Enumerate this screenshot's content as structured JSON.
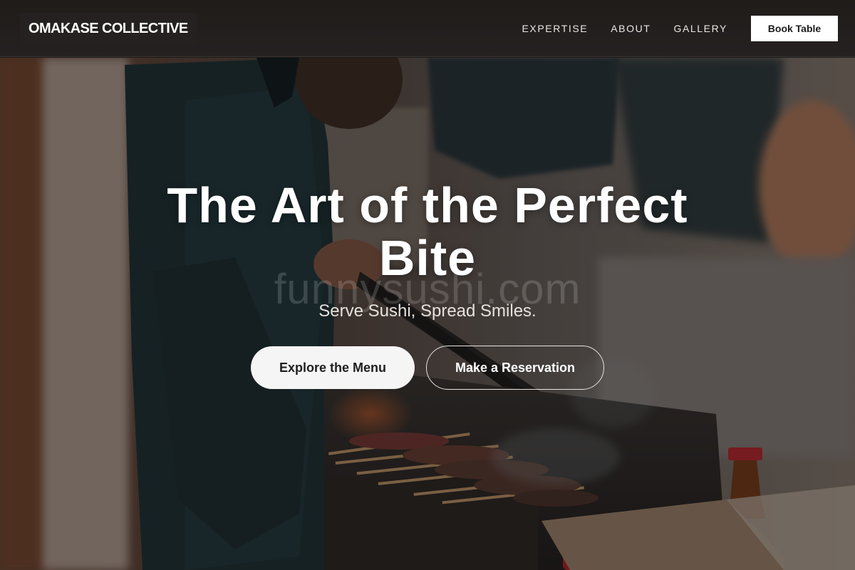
{
  "header": {
    "logo": "OMAKASE COLLECTIVE",
    "nav": [
      {
        "label": "EXPERTISE"
      },
      {
        "label": "ABOUT"
      },
      {
        "label": "GALLERY"
      }
    ],
    "book_label": "Book Table"
  },
  "hero": {
    "title": "The Art of the Perfect Bite",
    "watermark": "funnysushi.com",
    "subtitle": "Serve Sushi, Spread Smiles.",
    "primary_cta": "Explore the Menu",
    "secondary_cta": "Make a Reservation",
    "image_subject": "chef-grilling-yakitori"
  },
  "colors": {
    "header_bg": "#222",
    "cta_primary_bg": "#f5f5f6",
    "cta_text_dark": "#1f1f1f",
    "text_light": "#ffffff"
  }
}
